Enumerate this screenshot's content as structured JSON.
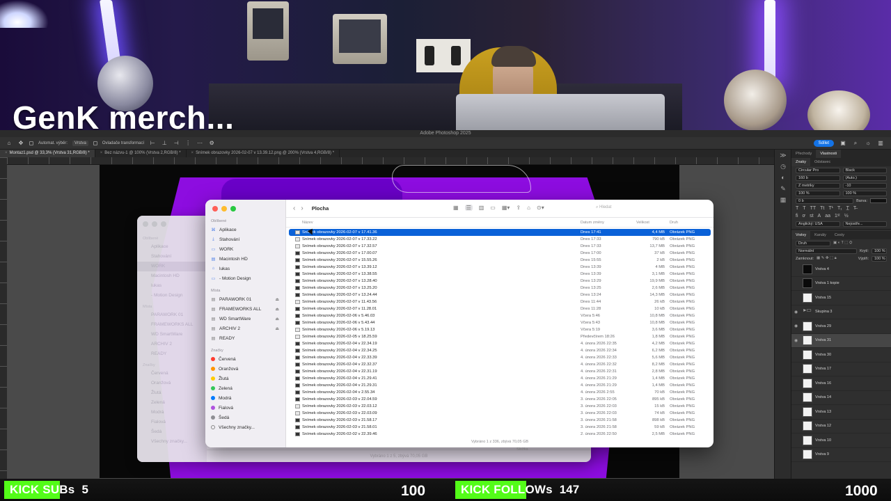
{
  "overlay": {
    "title": "GenK merch..."
  },
  "photoshop": {
    "app_title": "Adobe Photoshop 2025",
    "toolbar": {
      "auto_select": "Automat. výběr:",
      "layer_select": "Vrstva",
      "transform_controls": "Ovladače transformací",
      "share": "Sdílet"
    },
    "tabs": [
      "Montaz1.psd @ 33,3% (Vrstva 31,RGB/8) *",
      "Bez názvu-1 @ 100% (Vrstva 2,RGB/8) *",
      "Snímek obrazovky 2026-02-07 v 13.39.12.png @ 200% (Vrstva 4,RGB/8) *"
    ],
    "panels": {
      "top_tabs": [
        "Přechody",
        "Vlastnosti"
      ],
      "char_tabs": [
        "Znaky",
        "Odstavec"
      ],
      "font_family": "Circular Pro",
      "font_style": "Black",
      "font_size": "160 b",
      "leading": "(Auto.)",
      "kerning": "Z metriky",
      "tracking": "-10",
      "vscale": "100 %",
      "hscale": "100 %",
      "baseline": "0 b",
      "color_label": "Barva:",
      "language": "Anglický: USA",
      "antialias": "Nejostře...",
      "layer_tabs": [
        "Vrstvy",
        "Kanály",
        "Cesty"
      ],
      "filter_kind": "Druh",
      "blend_mode": "Normální",
      "opacity_label": "Krytí:",
      "opacity_value": "100 %",
      "lock_label": "Zamknout:",
      "fill_label": "Výplň:",
      "fill_value": "100 %",
      "layers": [
        {
          "name": "Vrstva 4",
          "thumb": "dark",
          "eye": false,
          "selected": false
        },
        {
          "name": "Vrstva 1 kopie",
          "thumb": "dark",
          "eye": false,
          "selected": false
        },
        {
          "name": "Vrstva 15",
          "thumb": "light",
          "eye": false,
          "selected": false
        },
        {
          "name": "Skupina 3",
          "thumb": "folder",
          "eye": true,
          "selected": false
        },
        {
          "name": "Vrstva 29",
          "thumb": "light",
          "eye": true,
          "selected": false
        },
        {
          "name": "Vrstva 31",
          "thumb": "light",
          "eye": true,
          "selected": true
        },
        {
          "name": "Vrstva 30",
          "thumb": "light",
          "eye": false,
          "selected": false
        },
        {
          "name": "Vrstva 17",
          "thumb": "light",
          "eye": false,
          "selected": false
        },
        {
          "name": "Vrstva 16",
          "thumb": "light",
          "eye": false,
          "selected": false
        },
        {
          "name": "Vrstva 14",
          "thumb": "light",
          "eye": false,
          "selected": false
        },
        {
          "name": "Vrstva 13",
          "thumb": "light",
          "eye": false,
          "selected": false
        },
        {
          "name": "Vrstva 12",
          "thumb": "light",
          "eye": false,
          "selected": false
        },
        {
          "name": "Vrstva 10",
          "thumb": "light",
          "eye": false,
          "selected": false
        },
        {
          "name": "Vrstva 9",
          "thumb": "light",
          "eye": false,
          "selected": false
        }
      ]
    }
  },
  "finder_back": {
    "sections": [
      {
        "head": "Oblíbené",
        "items": [
          "Aplikace",
          "Stahování",
          "WORK",
          "Macintosh HD",
          "lukas",
          "- Motion Design"
        ]
      },
      {
        "head": "Místa",
        "items": [
          "PARAWORK 01",
          "FRAMEWORKS ALL",
          "WD SmartWare",
          "ARCHIV 2",
          "READY"
        ]
      },
      {
        "head": "Značky",
        "items": [
          "Červená",
          "Oranžová",
          "Žlutá",
          "Zelená",
          "Modrá",
          "Fialová",
          "Šedá",
          "Všechny značky..."
        ]
      }
    ],
    "status": "Vybráno 1 z 5, zbývá 70,05 GB",
    "col_kind": "Složka"
  },
  "finder": {
    "title": "Plocha",
    "search_placeholder": "Hledat",
    "columns": {
      "name": "Název",
      "date": "Datum změny",
      "size": "Velikost",
      "kind": "Druh"
    },
    "sidebar": {
      "favorites_head": "Oblíbené",
      "favorites": [
        {
          "label": "Aplikace",
          "icon": "apps-icon"
        },
        {
          "label": "Stahování",
          "icon": "downloads-icon"
        },
        {
          "label": "WORK",
          "icon": "folder-icon"
        },
        {
          "label": "Macintosh HD",
          "icon": "disk-icon"
        },
        {
          "label": "lukas",
          "icon": "home-icon"
        },
        {
          "label": "- Motion Design",
          "icon": "folder-icon"
        }
      ],
      "places_head": "Místa",
      "places": [
        "PARAWORK 01",
        "FRAMEWORKS ALL",
        "WD SmartWare",
        "ARCHIV 2",
        "READY"
      ],
      "places_eject": [
        true,
        true,
        true,
        true,
        false
      ],
      "tags_head": "Značky",
      "tags": [
        {
          "label": "Červená",
          "color": "#ff3b30"
        },
        {
          "label": "Oranžová",
          "color": "#ff9500"
        },
        {
          "label": "Žlutá",
          "color": "#ffcc00"
        },
        {
          "label": "Zelená",
          "color": "#34c759"
        },
        {
          "label": "Modrá",
          "color": "#007aff"
        },
        {
          "label": "Fialová",
          "color": "#af52de"
        },
        {
          "label": "Šedá",
          "color": "#8e8e93"
        },
        {
          "label": "Všechny značky...",
          "color": ""
        }
      ]
    },
    "files": [
      {
        "name": "Snímek obrazovky 2026-02-07 v 17.41.36",
        "date": "Dnes 17:41",
        "size": "4,4 MB",
        "kind": "Obrázek PNG",
        "dark": false
      },
      {
        "name": "Snímek obrazovky 2026-02-07 v 17.33.22",
        "date": "Dnes 17:33",
        "size": "790 kB",
        "kind": "Obrázek PNG",
        "dark": false
      },
      {
        "name": "Snímek obrazovky 2026-02-07 v 17.32.57",
        "date": "Dnes 17:33",
        "size": "13,7 MB",
        "kind": "Obrázek PNG",
        "dark": false
      },
      {
        "name": "Snímek obrazovky 2026-02-07 v 17.00.07",
        "date": "Dnes 17:00",
        "size": "37 kB",
        "kind": "Obrázek PNG",
        "dark": true
      },
      {
        "name": "Snímek obrazovky 2026-02-07 v 15.55.26",
        "date": "Dnes 15:55",
        "size": "2 kB",
        "kind": "Obrázek PNG",
        "dark": true
      },
      {
        "name": "Snímek obrazovky 2026-02-07 v 13.39.12",
        "date": "Dnes 13:39",
        "size": "4 MB",
        "kind": "Obrázek PNG",
        "dark": true
      },
      {
        "name": "Snímek obrazovky 2026-02-07 v 13.38.55",
        "date": "Dnes 13:39",
        "size": "3,1 MB",
        "kind": "Obrázek PNG",
        "dark": true
      },
      {
        "name": "Snímek obrazovky 2026-02-07 v 13.28.40",
        "date": "Dnes 13:29",
        "size": "19,9 MB",
        "kind": "Obrázek PNG",
        "dark": true
      },
      {
        "name": "Snímek obrazovky 2026-02-07 v 13.25.20",
        "date": "Dnes 13:25",
        "size": "2,6 MB",
        "kind": "Obrázek PNG",
        "dark": true
      },
      {
        "name": "Snímek obrazovky 2026-02-07 v 13.24.44",
        "date": "Dnes 13:24",
        "size": "14,3 MB",
        "kind": "Obrázek PNG",
        "dark": true
      },
      {
        "name": "Snímek obrazovky 2026-02-07 v 11.43.56",
        "date": "Dnes 11:44",
        "size": "26 kB",
        "kind": "Obrázek PNG",
        "dark": false
      },
      {
        "name": "Snímek obrazovky 2026-02-07 v 11.28.01",
        "date": "Dnes 11:28",
        "size": "10 kB",
        "kind": "Obrázek PNG",
        "dark": true
      },
      {
        "name": "Snímek obrazovky 2026-02-06 v 5.46.03",
        "date": "Včera 5:46",
        "size": "10,8 MB",
        "kind": "Obrázek PNG",
        "dark": true
      },
      {
        "name": "Snímek obrazovky 2026-02-06 v 5.43.44",
        "date": "Včera 5:43",
        "size": "10,8 MB",
        "kind": "Obrázek PNG",
        "dark": true
      },
      {
        "name": "Snímek obrazovky 2026-02-06 v 5.19.13",
        "date": "Včera 5:19",
        "size": "3,6 MB",
        "kind": "Obrázek PNG",
        "dark": false
      },
      {
        "name": "Snímek obrazovky 2026-02-05 v 18.25.59",
        "date": "Předevčírem 18:26",
        "size": "1,8 MB",
        "kind": "Obrázek PNG",
        "dark": false
      },
      {
        "name": "Snímek obrazovky 2026-02-04 v 22.34.19",
        "date": "4. února 2026 22:35",
        "size": "4,2 MB",
        "kind": "Obrázek PNG",
        "dark": true
      },
      {
        "name": "Snímek obrazovky 2026-02-04 v 22.34.25",
        "date": "4. února 2026 22:34",
        "size": "6,2 MB",
        "kind": "Obrázek PNG",
        "dark": true
      },
      {
        "name": "Snímek obrazovky 2026-02-04 v 22.33.39",
        "date": "4. února 2026 22:33",
        "size": "5,6 MB",
        "kind": "Obrázek PNG",
        "dark": true
      },
      {
        "name": "Snímek obrazovky 2026-02-04 v 22.32.37",
        "date": "4. února 2026 22:32",
        "size": "8,2 MB",
        "kind": "Obrázek PNG",
        "dark": true
      },
      {
        "name": "Snímek obrazovky 2026-02-04 v 22.31.19",
        "date": "4. února 2026 22:31",
        "size": "2,8 MB",
        "kind": "Obrázek PNG",
        "dark": true
      },
      {
        "name": "Snímek obrazovky 2026-02-04 v 21.29.41",
        "date": "4. února 2026 21:29",
        "size": "1,4 MB",
        "kind": "Obrázek PNG",
        "dark": true
      },
      {
        "name": "Snímek obrazovky 2026-02-04 v 21.29.31",
        "date": "4. února 2026 21:29",
        "size": "1,4 MB",
        "kind": "Obrázek PNG",
        "dark": true
      },
      {
        "name": "Snímek obrazovky 2026-02-04 v 2.55.34",
        "date": "4. února 2026 2:55",
        "size": "70 kB",
        "kind": "Obrázek PNG",
        "dark": true
      },
      {
        "name": "Snímek obrazovky 2026-02-03 v 22.04.59",
        "date": "3. února 2026 22:05",
        "size": "895 kB",
        "kind": "Obrázek PNG",
        "dark": true
      },
      {
        "name": "Snímek obrazovky 2026-02-03 v 22.03.12",
        "date": "3. února 2026 22:03",
        "size": "15 kB",
        "kind": "Obrázek PNG",
        "dark": false
      },
      {
        "name": "Snímek obrazovky 2026-02-03 v 22.03.09",
        "date": "3. února 2026 22:03",
        "size": "74 kB",
        "kind": "Obrázek PNG",
        "dark": false
      },
      {
        "name": "Snímek obrazovky 2026-02-03 v 21.58.17",
        "date": "3. února 2026 21:58",
        "size": "898 kB",
        "kind": "Obrázek PNG",
        "dark": true
      },
      {
        "name": "Snímek obrazovky 2026-02-03 v 21.58.01",
        "date": "3. února 2026 21:58",
        "size": "59 kB",
        "kind": "Obrázek PNG",
        "dark": true
      },
      {
        "name": "Snímek obrazovky 2026-02-02 v 22.39.46",
        "date": "2. února 2026 22:50",
        "size": "2,5 MB",
        "kind": "Obrázek PNG",
        "dark": true
      }
    ],
    "status": "Vybráno 1 z 336, zbývá 70,05 GB"
  },
  "stream": {
    "subs": {
      "label": "KICK SUBs",
      "count": "5",
      "target": "100",
      "progress": 0.05
    },
    "follows": {
      "label": "KICK FOLLOWs",
      "count": "147",
      "target": "1000",
      "progress": 0.147
    },
    "accent": "#53fc18"
  }
}
